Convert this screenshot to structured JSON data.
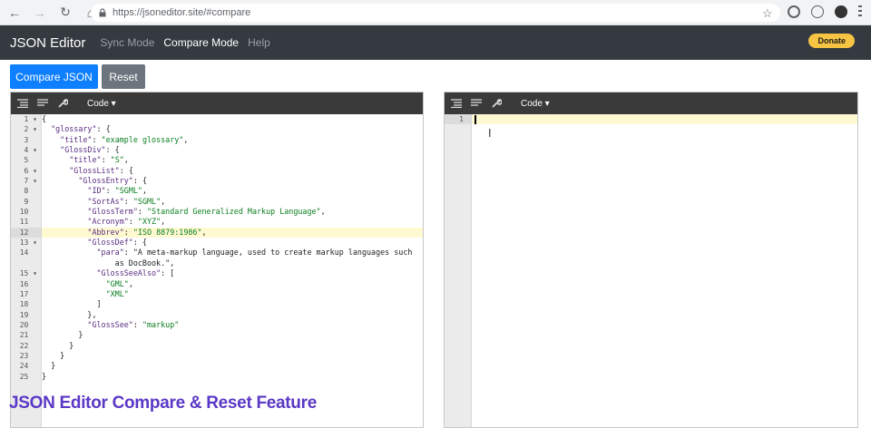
{
  "browser": {
    "url": "https://jsoneditor.site/#compare"
  },
  "header": {
    "brand": "JSON Editor",
    "nav": [
      "Sync Mode",
      "Compare Mode",
      "Help"
    ],
    "donate_label": "Donate"
  },
  "actions": {
    "compare_label": "Compare JSON",
    "reset_label": "Reset"
  },
  "left_editor": {
    "mode_label": "Code ▾",
    "active_line": 12,
    "lines": [
      {
        "n": "1",
        "fold": "▾",
        "html": "{"
      },
      {
        "n": "2",
        "fold": "▾",
        "html": "  \"glossary\": {"
      },
      {
        "n": "3",
        "fold": "",
        "html": "    \"title\": \"example glossary\","
      },
      {
        "n": "4",
        "fold": "▾",
        "html": "    \"GlossDiv\": {"
      },
      {
        "n": "5",
        "fold": "",
        "html": "      \"title\": \"S\","
      },
      {
        "n": "6",
        "fold": "▾",
        "html": "      \"GlossList\": {"
      },
      {
        "n": "7",
        "fold": "▾",
        "html": "        \"GlossEntry\": {"
      },
      {
        "n": "8",
        "fold": "",
        "html": "          \"ID\": \"SGML\","
      },
      {
        "n": "9",
        "fold": "",
        "html": "          \"SortAs\": \"SGML\","
      },
      {
        "n": "10",
        "fold": "",
        "html": "          \"GlossTerm\": \"Standard Generalized Markup Language\","
      },
      {
        "n": "11",
        "fold": "",
        "html": "          \"Acronym\": \"XYZ\","
      },
      {
        "n": "12",
        "fold": "",
        "html": "          \"Abbrev\": \"ISO 8879:1986\","
      },
      {
        "n": "13",
        "fold": "▾",
        "html": "          \"GlossDef\": {"
      },
      {
        "n": "14",
        "fold": "",
        "html": "            \"para\": \"A meta-markup language, used to create markup languages such"
      },
      {
        "n": "",
        "fold": "",
        "html": "                as DocBook.\","
      },
      {
        "n": "15",
        "fold": "▾",
        "html": "            \"GlossSeeAlso\": ["
      },
      {
        "n": "16",
        "fold": "",
        "html": "              \"GML\","
      },
      {
        "n": "17",
        "fold": "",
        "html": "              \"XML\""
      },
      {
        "n": "18",
        "fold": "",
        "html": "            ]"
      },
      {
        "n": "19",
        "fold": "",
        "html": "          },"
      },
      {
        "n": "20",
        "fold": "",
        "html": "          \"GlossSee\": \"markup\""
      },
      {
        "n": "21",
        "fold": "",
        "html": "        }"
      },
      {
        "n": "22",
        "fold": "",
        "html": "      }"
      },
      {
        "n": "23",
        "fold": "",
        "html": "    }"
      },
      {
        "n": "24",
        "fold": "",
        "html": "  }"
      },
      {
        "n": "25",
        "fold": "",
        "html": "}"
      }
    ]
  },
  "right_editor": {
    "mode_label": "Code ▾",
    "line_number": "1"
  },
  "overlay": {
    "title": "JSON Editor Compare & Reset Feature"
  }
}
